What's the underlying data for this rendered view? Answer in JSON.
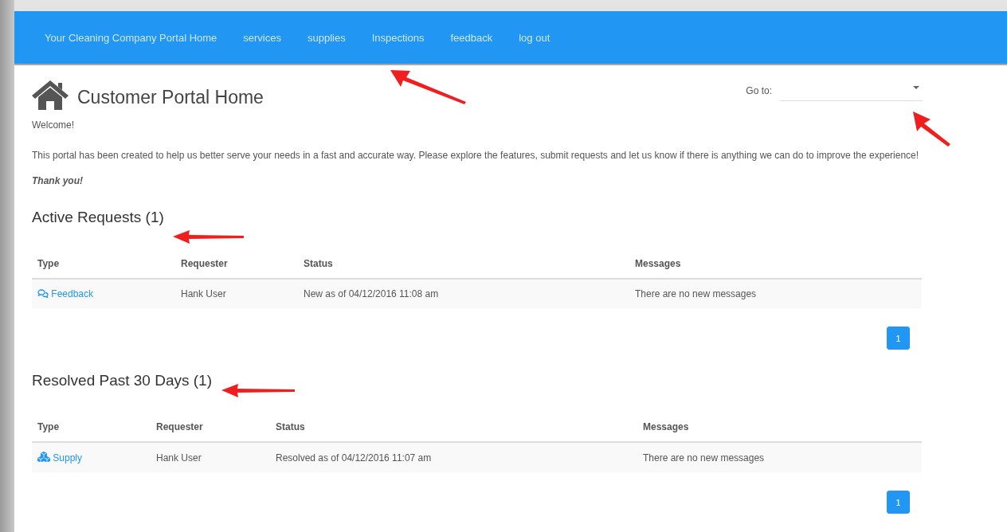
{
  "navbar": {
    "brand": "Your Cleaning Company Portal Home",
    "links": [
      "services",
      "supplies",
      "Inspections",
      "feedback",
      "log out"
    ]
  },
  "header": {
    "title": "Customer Portal Home",
    "goto_label": "Go to:"
  },
  "intro": {
    "greeting": "Welcome!",
    "paragraph": "This portal has been created to help us better serve your needs in a fast and accurate way. Please explore the features, submit requests and let us know if there is anything we can do to improve the experience!",
    "signoff": "Thank you!"
  },
  "sections": [
    {
      "title": "Active Requests (1)",
      "columns": [
        "Type",
        "Requester",
        "Status",
        "Messages"
      ],
      "rows": [
        {
          "kind": "feedback",
          "type": "Feedback",
          "requester": "Hank User",
          "status": "New as of 04/12/2016 11:08 am",
          "messages": "There are no new messages"
        }
      ],
      "pages": [
        {
          "label": "1",
          "selected": true
        }
      ]
    },
    {
      "title": "Resolved Past 30 Days (1)",
      "columns": [
        "Type",
        "Requester",
        "Status",
        "Messages"
      ],
      "rows": [
        {
          "kind": "supply",
          "type": "Supply",
          "requester": "Hank User",
          "status": "Resolved as of 04/12/2016 11:07 am",
          "messages": "There are no new messages"
        }
      ],
      "pages": [
        {
          "label": "1",
          "selected": true
        }
      ]
    }
  ]
}
